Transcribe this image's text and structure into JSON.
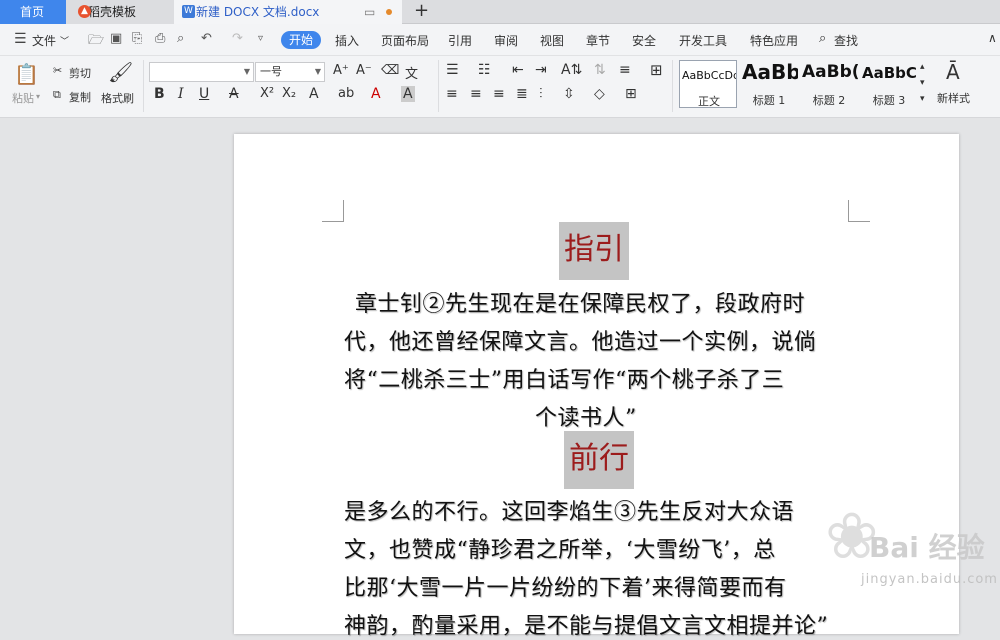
{
  "tabs": {
    "home": "首页",
    "templates": "稻壳模板",
    "document": "新建 DOCX 文档.docx",
    "add": "+"
  },
  "menu": {
    "file": "文件",
    "items": [
      "开始",
      "插入",
      "页面布局",
      "引用",
      "审阅",
      "视图",
      "章节",
      "安全",
      "开发工具",
      "特色应用"
    ],
    "search": "查找"
  },
  "ribbon": {
    "paste": "粘贴",
    "cut": "剪切",
    "copy": "复制",
    "format_painter": "格式刷",
    "font_name": "",
    "font_size": "一号",
    "styles": [
      {
        "sample": "AaBbCcDd",
        "label": "正文"
      },
      {
        "sample": "AaBb",
        "label": "标题 1"
      },
      {
        "sample": "AaBb(",
        "label": "标题 2"
      },
      {
        "sample": "AaBbC",
        "label": "标题 3"
      }
    ],
    "new_style": "新样式"
  },
  "document": {
    "heading1": "指引",
    "para1": [
      "章士钊②先生现在是在保障民权了，段政府时",
      "代，他还曾经保障文言。他造过一个实例，说倘",
      "将“二桃杀三士”用白话写作“两个桃子杀了三",
      "个读书人”"
    ],
    "heading2": "前行",
    "para2": [
      "是多么的不行。这回李焰生③先生反对大众语",
      "文，也赞成“静珍君之所举，‘大雪纷飞’，总",
      "比那‘大雪一片一片纷纷的下着’来得简要而有",
      "神韵，酌量采用，是不能与提倡文言文相提并论”"
    ]
  },
  "watermark": {
    "text": "Bai 经验",
    "url": "jingyan.baidu.com"
  },
  "colors": {
    "accent": "#3f86ec",
    "heading_text": "#9c1c1c",
    "heading_highlight": "#c4c4c4"
  }
}
